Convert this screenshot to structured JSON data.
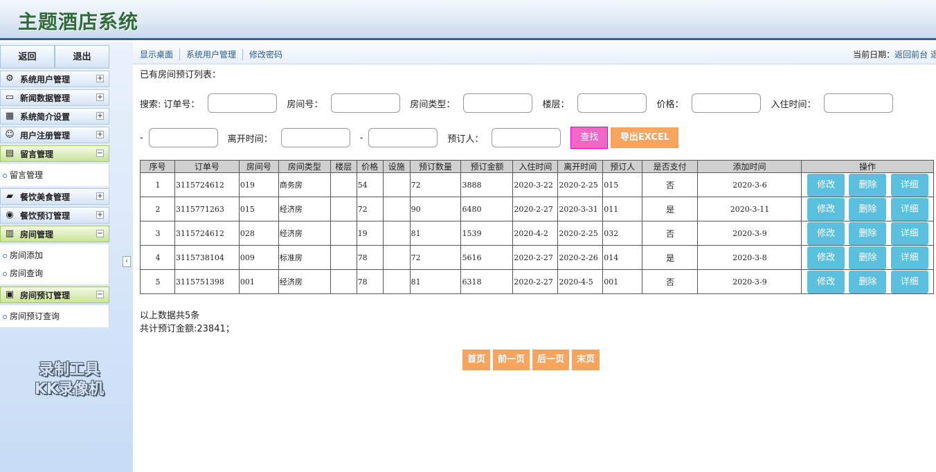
{
  "header": {
    "title": "主题酒店系统"
  },
  "sidebar": {
    "top_buttons": [
      "返回",
      "退出"
    ],
    "menus": [
      {
        "label": "系统用户管理",
        "icon": "gear-icon",
        "open": false
      },
      {
        "label": "新闻数据管理",
        "icon": "monitor-icon",
        "open": false
      },
      {
        "label": "系统简介设置",
        "icon": "grid-icon",
        "open": false
      },
      {
        "label": "用户注册管理",
        "icon": "user-icon",
        "open": false
      },
      {
        "label": "留言管理",
        "icon": "calendar-icon",
        "open": true,
        "items": [
          "留言管理"
        ]
      },
      {
        "label": "餐饮美食管理",
        "icon": "folder-icon",
        "open": false
      },
      {
        "label": "餐饮预订管理",
        "icon": "coins-icon",
        "open": false
      },
      {
        "label": "房间管理",
        "icon": "bar-chart-icon",
        "open": true,
        "items": [
          "房间添加",
          "房间查询"
        ]
      },
      {
        "label": "房间预订管理",
        "icon": "chip-icon",
        "open": true,
        "items": [
          "房间预订查询"
        ]
      }
    ],
    "watermark": [
      "录制工具",
      "KK录像机"
    ]
  },
  "topbar": {
    "links": [
      "显示桌面",
      "系统用户管理",
      "修改密码"
    ],
    "date_label": "当前日期：",
    "date_link": "返回前台 退"
  },
  "content": {
    "list_title": "已有房间预订列表：",
    "search_prefix": "搜索:",
    "search_row1": [
      "订单号：",
      "房间号：",
      "房间类型：",
      "楼层：",
      "价格：",
      "入住时间："
    ],
    "search_row2": [
      "-",
      "离开时间：",
      "-",
      "预订人："
    ],
    "find_button": "查找",
    "export_button": "导出EXCEL",
    "columns": [
      "序号",
      "订单号",
      "房间号",
      "房间类型",
      "楼层",
      "价格",
      "设施",
      "预订数量",
      "预订金额",
      "入住时间",
      "离开时间",
      "预订人",
      "是否支付",
      "添加时间",
      "操作"
    ],
    "rows": [
      [
        "1",
        "3115724612",
        "019",
        "商务房",
        "",
        "54",
        "",
        "72",
        "3888",
        "2020-3-22",
        "2020-2-25",
        "015",
        "否",
        "2020-3-6"
      ],
      [
        "2",
        "3115771263",
        "015",
        "经济房",
        "",
        "72",
        "",
        "90",
        "6480",
        "2020-2-27",
        "2020-3-31",
        "011",
        "是",
        "2020-3-11"
      ],
      [
        "3",
        "3115724612",
        "028",
        "经济房",
        "",
        "19",
        "",
        "81",
        "1539",
        "2020-4-2",
        "2020-2-25",
        "032",
        "否",
        "2020-3-9"
      ],
      [
        "4",
        "3115738104",
        "009",
        "标准房",
        "",
        "78",
        "",
        "72",
        "5616",
        "2020-2-27",
        "2020-2-26",
        "014",
        "是",
        "2020-3-8"
      ],
      [
        "5",
        "3115751398",
        "001",
        "经济房",
        "",
        "78",
        "",
        "81",
        "6318",
        "2020-2-27",
        "2020-4-5",
        "001",
        "否",
        "2020-3-9"
      ]
    ],
    "row_actions": [
      "修改",
      "删除",
      "详细"
    ],
    "summary_count": "以上数据共5条",
    "summary_total": "共计预订金额:23841；",
    "pager": [
      "首页",
      "前一页",
      "后一页",
      "末页"
    ]
  }
}
